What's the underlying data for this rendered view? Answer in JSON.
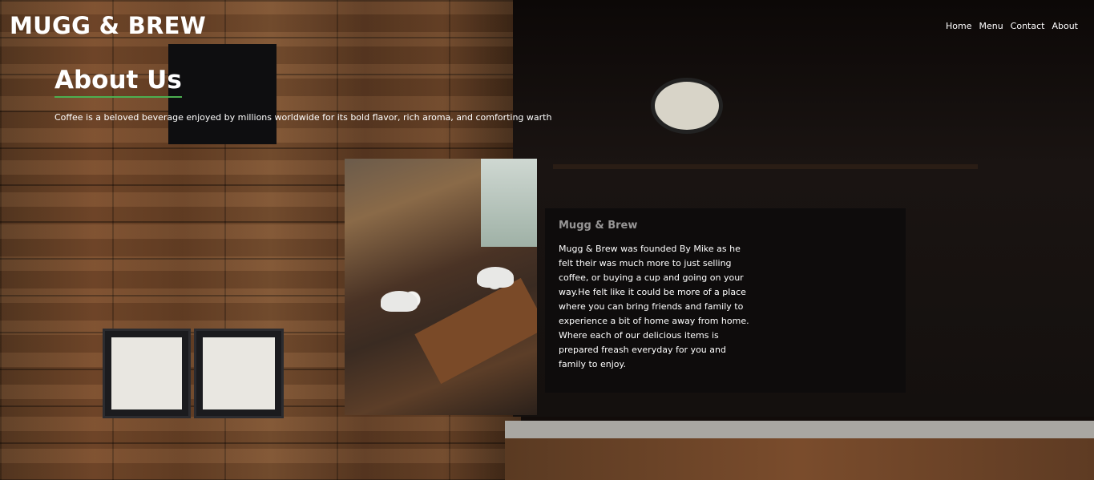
{
  "site": {
    "logo": "MUGG & BREW"
  },
  "nav": {
    "items": [
      {
        "label": "Home"
      },
      {
        "label": "Menu"
      },
      {
        "label": "Contact"
      },
      {
        "label": "About"
      }
    ]
  },
  "about": {
    "title": "About Us",
    "lead": "Coffee is a beloved beverage enjoyed by millions worldwide for its bold flavor, rich aroma, and comforting warth",
    "subtitle": "Mugg & Brew",
    "story": "Mugg & Brew was founded By Mike as he felt their was much more to just selling coffee, or buying a cup and going on your way.He felt like it could be more of a place where you can bring friends and family to experience a bit of home away from home. Where each of our delicious items is prepared freash everyday for you and family to enjoy."
  },
  "colors": {
    "accent_underline": "#4caf50",
    "text": "#ffffff"
  }
}
